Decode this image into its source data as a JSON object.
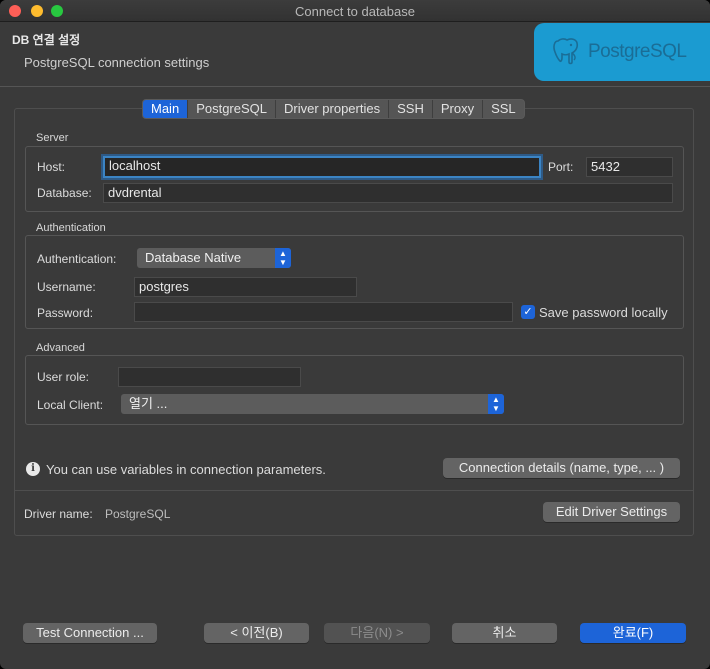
{
  "window": {
    "title": "Connect to database"
  },
  "header": {
    "title": "DB 연결 설정",
    "subtitle": "PostgreSQL connection settings",
    "logo_text": "PostgreSQL"
  },
  "tabs": [
    "Main",
    "PostgreSQL",
    "Driver properties",
    "SSH",
    "Proxy",
    "SSL"
  ],
  "server": {
    "label": "Server",
    "host_label": "Host:",
    "host_value": "localhost",
    "port_label": "Port:",
    "port_value": "5432",
    "database_label": "Database:",
    "database_value": "dvdrental"
  },
  "auth": {
    "label": "Authentication",
    "auth_label": "Authentication:",
    "auth_value": "Database Native",
    "username_label": "Username:",
    "username_value": "postgres",
    "password_label": "Password:",
    "password_value": "",
    "save_password_label": "Save password locally",
    "save_password_checked": true
  },
  "advanced": {
    "label": "Advanced",
    "user_role_label": "User role:",
    "user_role_value": "",
    "local_client_label": "Local Client:",
    "local_client_value": "열기 ..."
  },
  "info": {
    "text": "You can use variables in connection parameters.",
    "details_button": "Connection details (name, type, ... )"
  },
  "driver": {
    "name_label": "Driver name:",
    "name_value": "PostgreSQL",
    "edit_button": "Edit Driver Settings"
  },
  "footer": {
    "test_button": "Test Connection ...",
    "back_button": "< 이전(B)",
    "next_button": "다음(N) >",
    "cancel_button": "취소",
    "finish_button": "완료(F)"
  },
  "colors": {
    "accent": "#1d64d8",
    "logo_bg": "#1b9bd1",
    "window_bg": "#3a3a3a"
  }
}
